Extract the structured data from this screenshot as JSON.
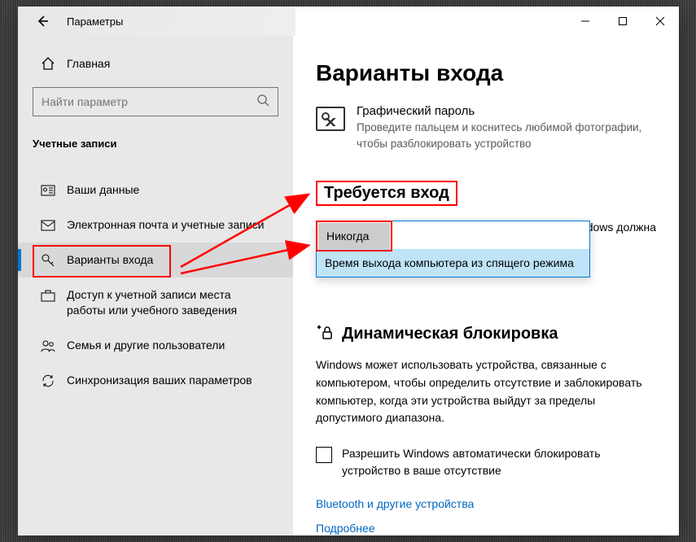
{
  "window": {
    "title": "Параметры"
  },
  "sidebar": {
    "home": "Главная",
    "search_placeholder": "Найти параметр",
    "section": "Учетные записи",
    "items": [
      {
        "label": "Ваши данные"
      },
      {
        "label": "Электронная почта и учетные записи"
      },
      {
        "label": "Варианты входа"
      },
      {
        "label": "Доступ к учетной записи места работы или учебного заведения"
      },
      {
        "label": "Семья и другие пользователи"
      },
      {
        "label": "Синхронизация ваших параметров"
      }
    ]
  },
  "content": {
    "page_title": "Варианты входа",
    "picture_password": {
      "title": "Графический пароль",
      "desc": "Проведите пальцем и коснитесь любимой фотографии, чтобы разблокировать устройство"
    },
    "require_signin": {
      "heading": "Требуется вход",
      "trailing": "Windows должна",
      "selected": "Никогда",
      "option": "Время выхода компьютера из спящего режима"
    },
    "dynamic_lock": {
      "heading": "Динамическая блокировка",
      "desc": "Windows может использовать устройства, связанные с компьютером, чтобы определить отсутствие и заблокировать компьютер, когда эти устройства выйдут за пределы допустимого диапазона.",
      "checkbox": "Разрешить Windows автоматически блокировать устройство в ваше отсутствие"
    },
    "links": {
      "bluetooth": "Bluetooth и другие устройства",
      "more": "Подробнее"
    }
  }
}
